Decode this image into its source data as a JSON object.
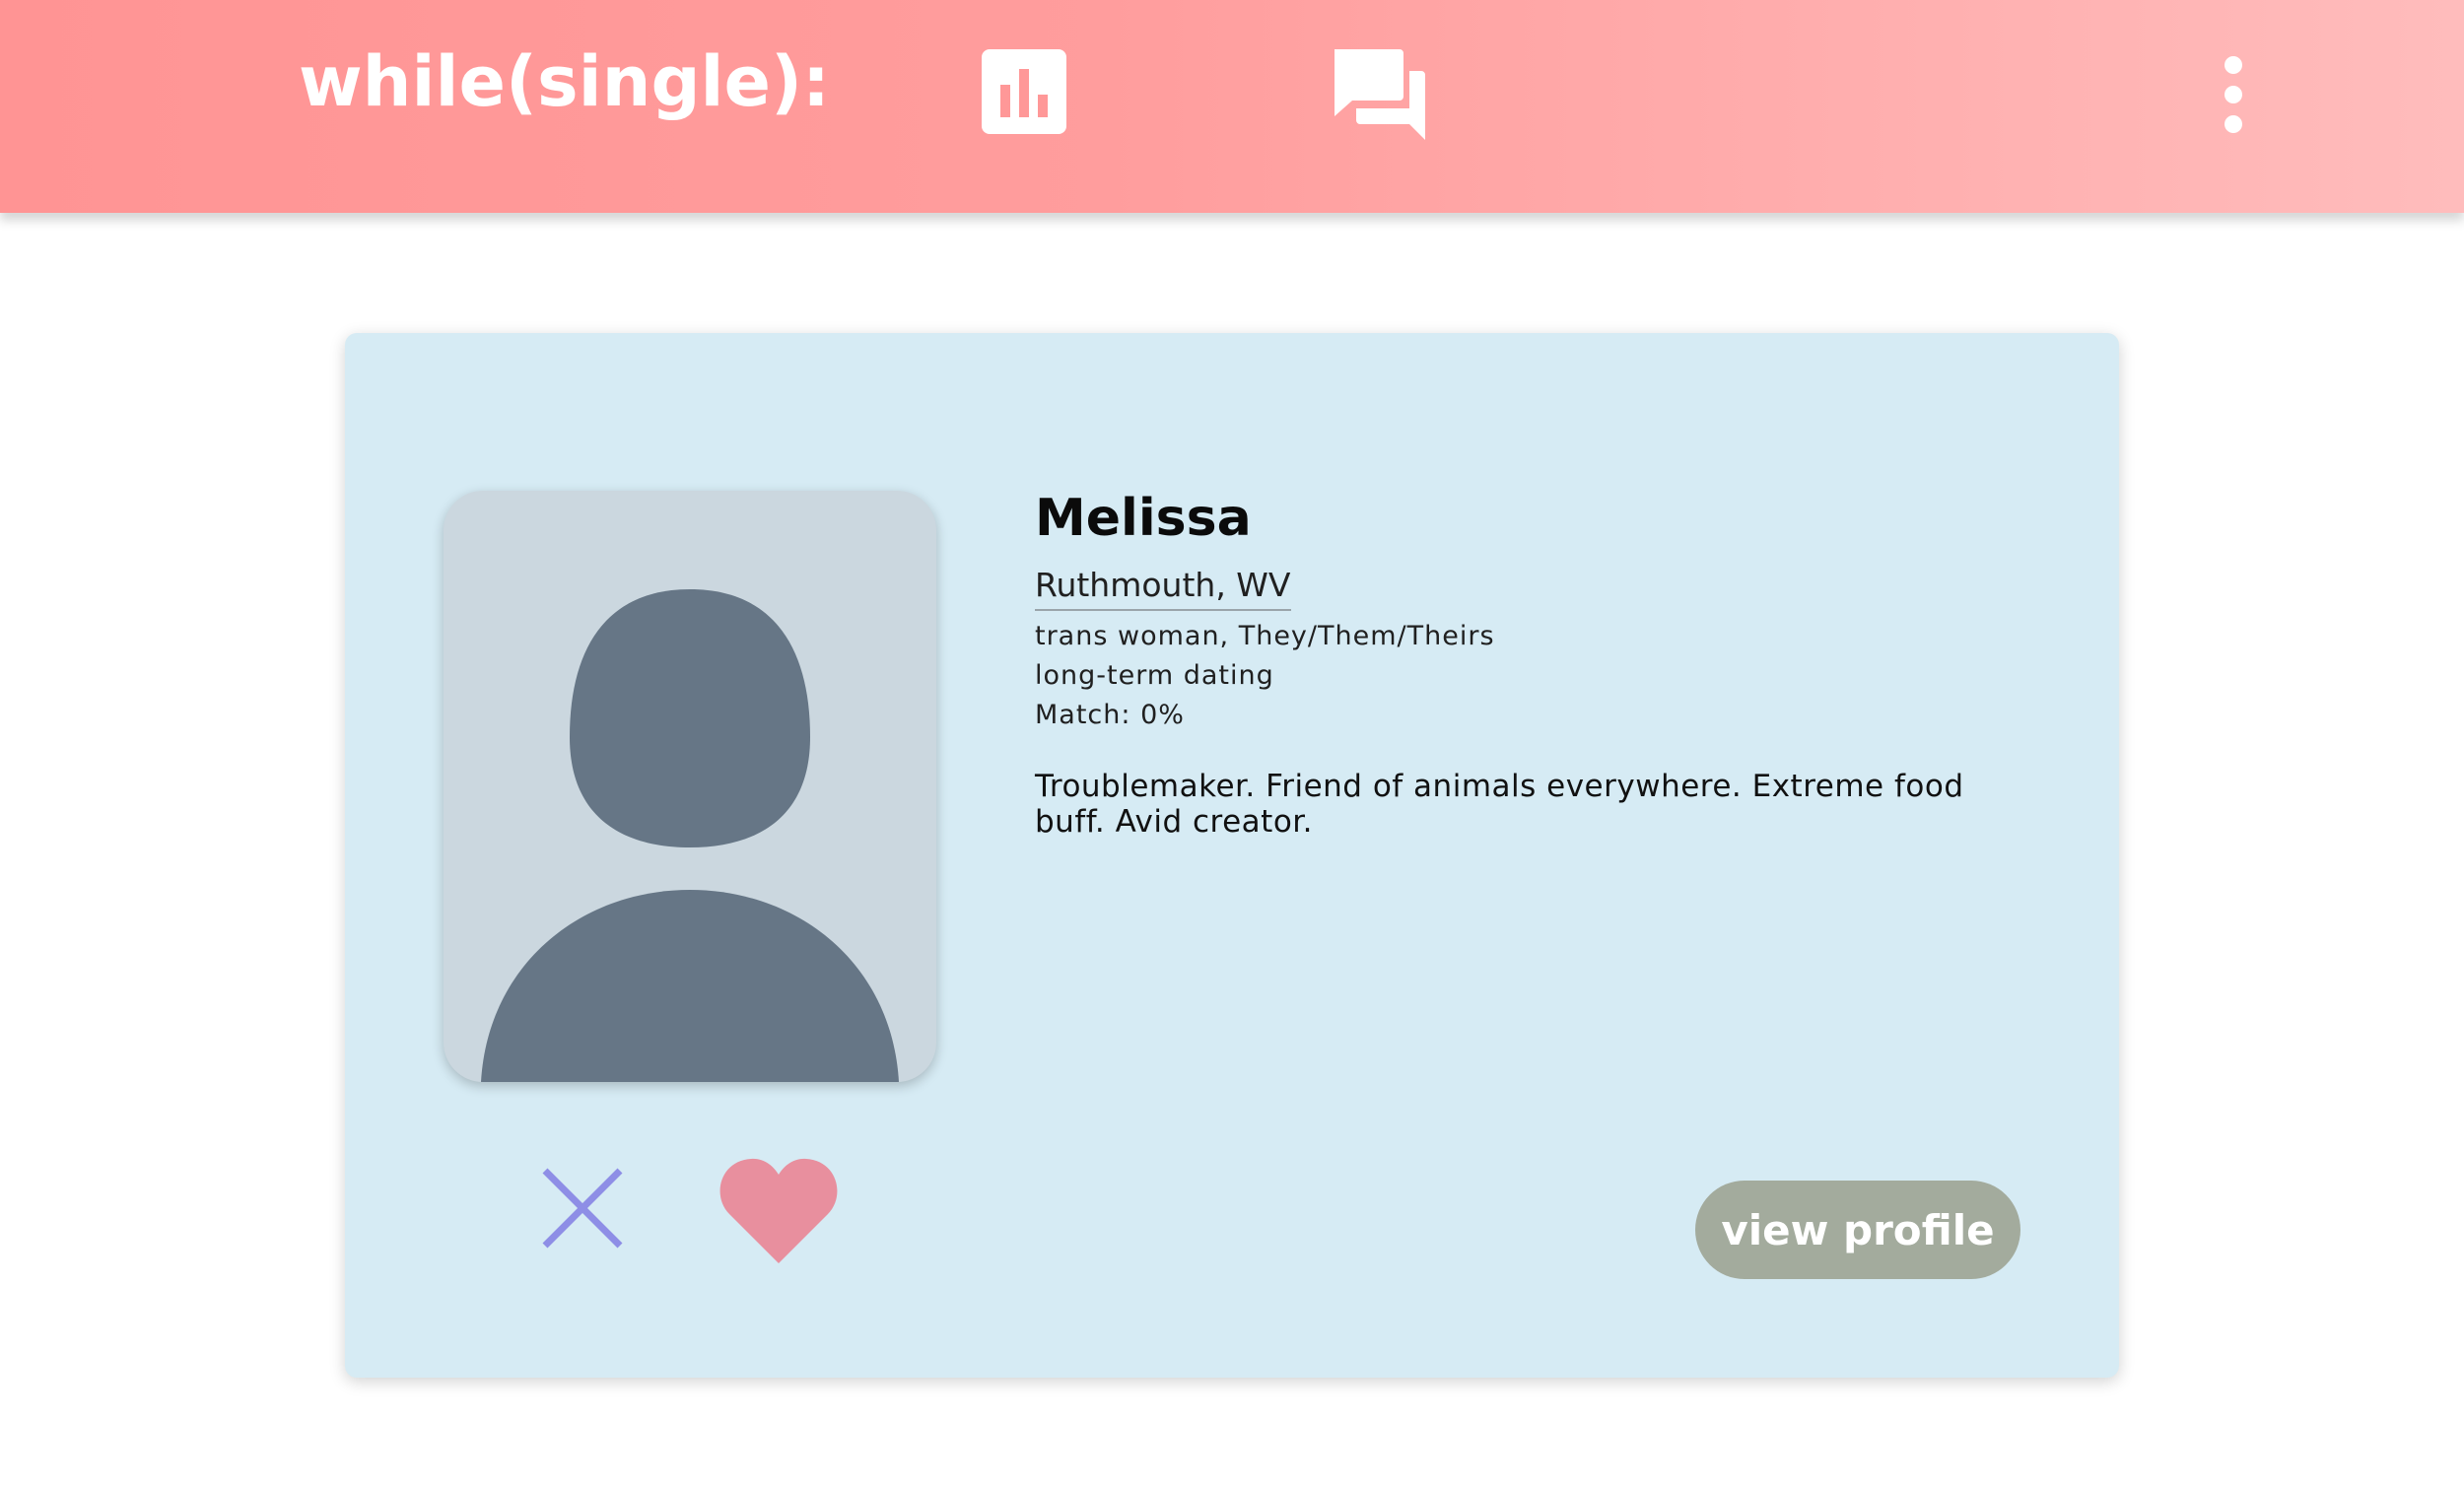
{
  "header": {
    "logo": "while(single):",
    "icons": {
      "stats": "bar-chart-icon",
      "chat": "chat-bubbles-icon",
      "menu": "more-vertical-icon"
    }
  },
  "profile": {
    "name": "Melissa",
    "location": "Ruthmouth, WV",
    "identity": "trans woman, They/Them/Theirs",
    "looking_for": "long-term dating",
    "match": "Match: 0%",
    "bio": "Troublemaker. Friend of animals everywhere. Extreme food buff. Avid creator.",
    "photo_icon": "avatar-placeholder"
  },
  "actions": {
    "reject_icon": "close-icon",
    "like_icon": "heart-icon",
    "view_profile": "view profile"
  },
  "colors": {
    "header_gradient_start": "#ff9494",
    "header_gradient_end": "#ffbcbc",
    "card_bg": "#d6ebf4",
    "avatar_bg": "#cbd7df",
    "avatar_fg": "#667686",
    "reject": "#8e8ee6",
    "like": "#e88f9e",
    "view_button": "#a3ab9d"
  }
}
